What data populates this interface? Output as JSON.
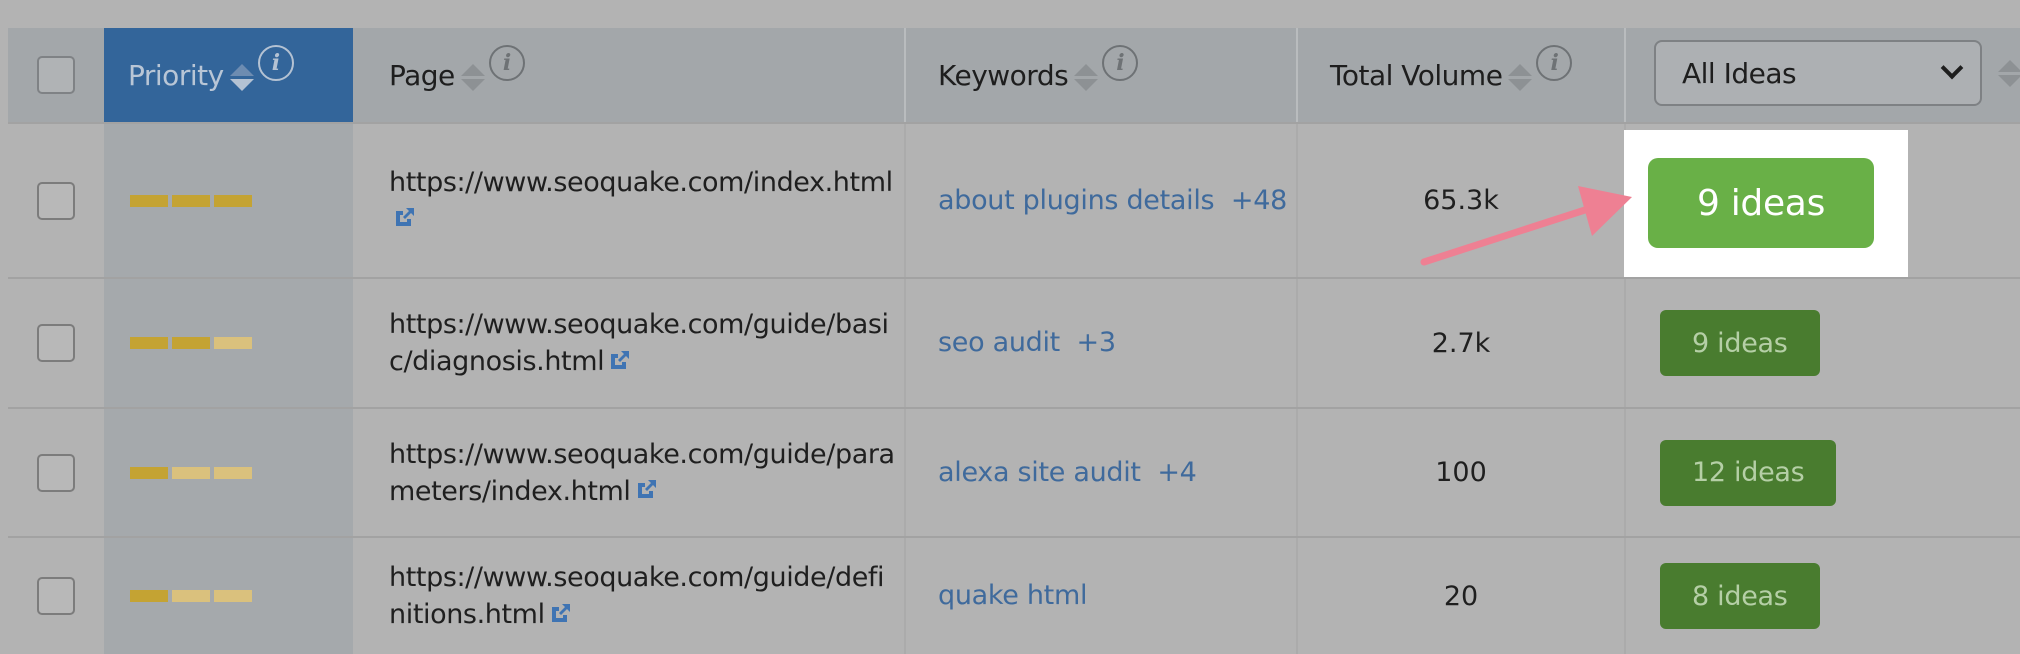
{
  "header": {
    "priority": "Priority",
    "page": "Page",
    "keywords": "Keywords",
    "total_volume": "Total Volume",
    "ideas_filter": {
      "selected": "All Ideas"
    }
  },
  "colors": {
    "priority_header": "#33659a",
    "link": "#3f6a9c",
    "priority_bar_on": "#c5a22c",
    "priority_bar_off": "#dcc27a",
    "ideas_button": "#497c2f",
    "ideas_button_highlighted": "#69b047",
    "annotation_arrow": "#ee8093"
  },
  "rows": [
    {
      "priority_level": 3,
      "priority_max": 3,
      "page_url": "https://www.seoquake.com/index.html",
      "keyword": "about plugins details",
      "keyword_more": "+48",
      "total_volume": "65.3k",
      "ideas": "9 ideas",
      "highlighted": true
    },
    {
      "priority_level": 2,
      "priority_max": 3,
      "page_url": "https://www.seoquake.com/guide/basic/diagnosis.html",
      "keyword": "seo audit",
      "keyword_more": "+3",
      "total_volume": "2.7k",
      "ideas": "9 ideas",
      "highlighted": false
    },
    {
      "priority_level": 1,
      "priority_max": 3,
      "page_url": "https://www.seoquake.com/guide/parameters/index.html",
      "keyword": "alexa site audit",
      "keyword_more": "+4",
      "total_volume": "100",
      "ideas": "12 ideas",
      "highlighted": false
    },
    {
      "priority_level": 1,
      "priority_max": 3,
      "page_url": "https://www.seoquake.com/guide/definitions.html",
      "keyword": "quake html",
      "keyword_more": "",
      "total_volume": "20",
      "ideas": "8 ideas",
      "highlighted": false
    }
  ]
}
